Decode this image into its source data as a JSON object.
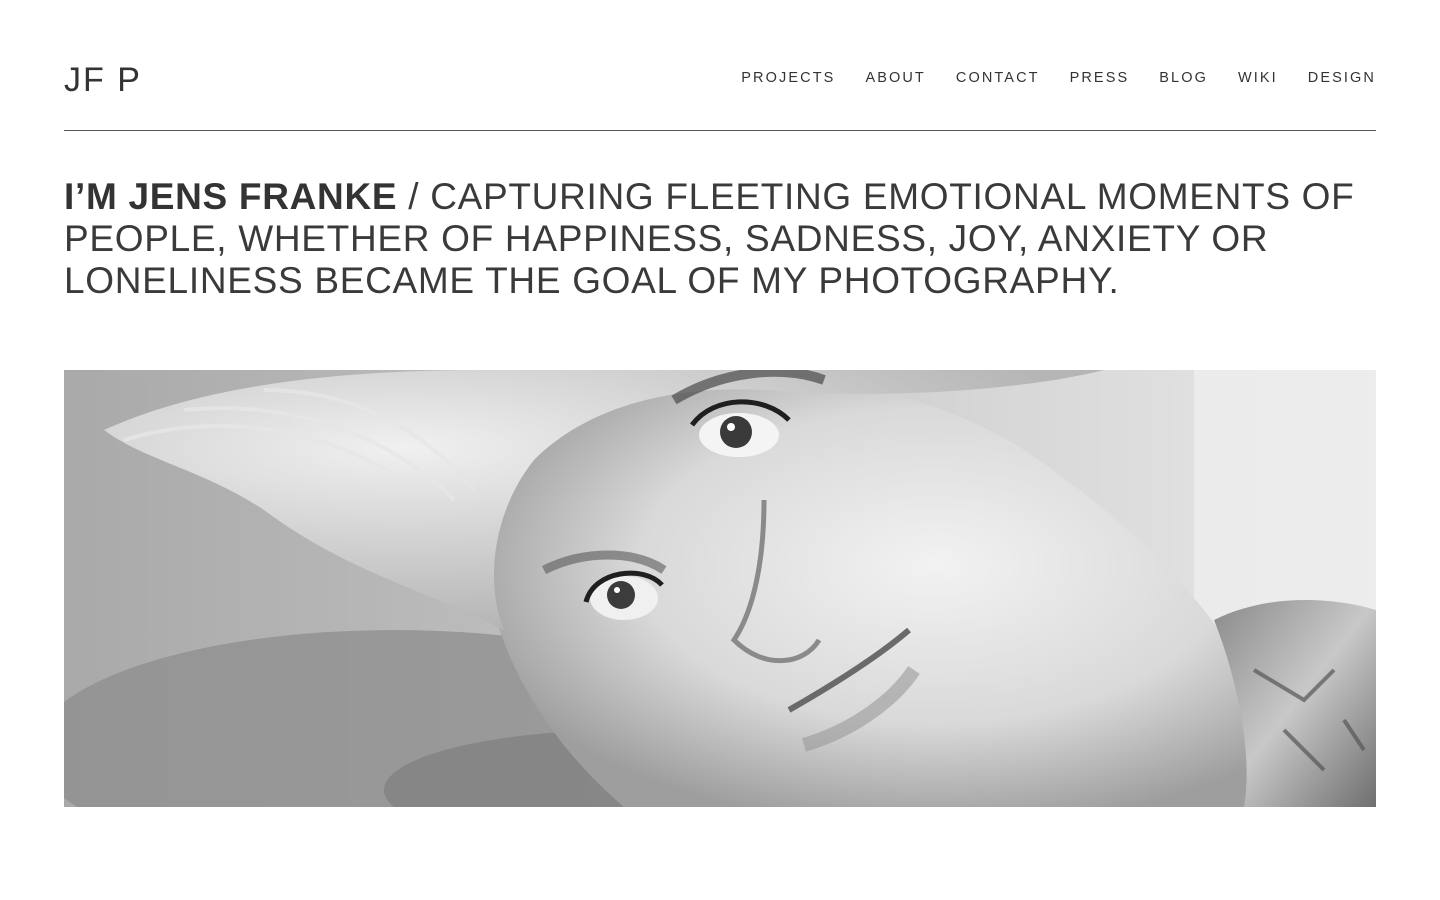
{
  "site": {
    "logo": "JF P"
  },
  "nav": {
    "items": [
      {
        "label": "PROJECTS"
      },
      {
        "label": "ABOUT"
      },
      {
        "label": "CONTACT"
      },
      {
        "label": "PRESS"
      },
      {
        "label": "BLOG"
      },
      {
        "label": "WIKI"
      },
      {
        "label": "DESIGN"
      }
    ]
  },
  "intro": {
    "name": "I’M JENS FRANKE",
    "text": " / CAPTURING FLEETING EMOTIONAL MOMENTS OF PEOPLE, WHETHER OF HAPPINESS, SADNESS, JOY, ANXIETY OR LONELINESS BECAME THE GOAL OF MY PHOTOGRAPHY."
  },
  "hero": {
    "description_icon": "portrait-photo"
  }
}
